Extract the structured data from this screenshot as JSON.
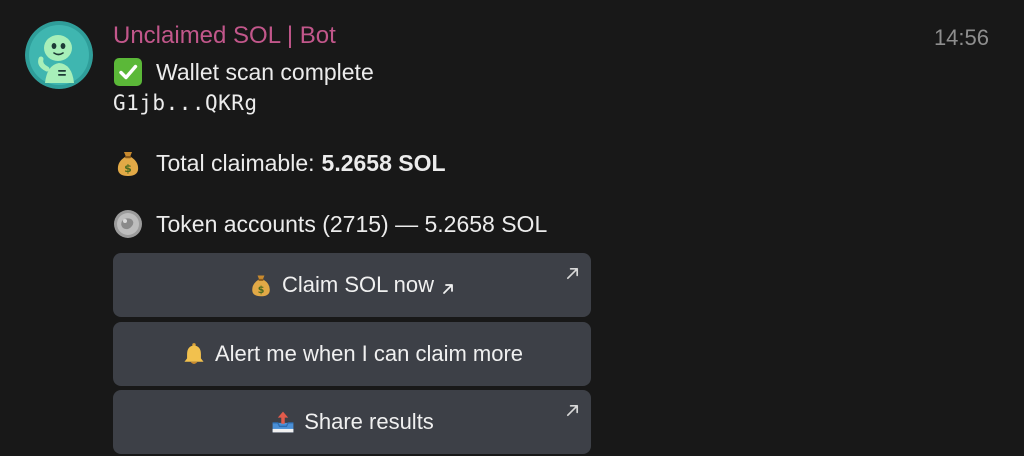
{
  "message": {
    "sender": "Unclaimed SOL | Bot",
    "time": "14:56",
    "status_text": "Wallet scan complete",
    "wallet": "G1jb...QKRg",
    "total_label": "Total claimable:",
    "total_value": "5.2658 SOL",
    "token_accounts": "Token accounts (2715) — 5.2658 SOL"
  },
  "buttons": [
    {
      "label": "Claim SOL now",
      "icon": "money-bag-icon",
      "external": true,
      "inline_arrow": true
    },
    {
      "label": "Alert me when I can claim more",
      "icon": "bell-icon",
      "external": false,
      "inline_arrow": false
    },
    {
      "label": "Share results",
      "icon": "outbox-tray-icon",
      "external": true,
      "inline_arrow": false
    }
  ],
  "colors": {
    "background": "#181818",
    "sender": "#c2578b",
    "button_bg": "#3d4047",
    "timestamp": "#8e8e8e"
  }
}
